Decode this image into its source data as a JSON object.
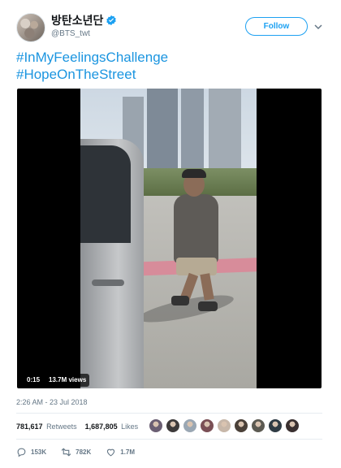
{
  "header": {
    "display_name": "방탄소년단",
    "handle": "@BTS_twt",
    "follow_label": "Follow"
  },
  "tweet": {
    "lines": [
      "#InMyFeelingsChallenge",
      "#HopeOnTheStreet"
    ]
  },
  "video": {
    "duration": "0:15",
    "views": "13.7M views"
  },
  "meta": {
    "timestamp": "2:26 AM - 23 Jul 2018",
    "retweets_count": "781,617",
    "retweets_label": "Retweets",
    "likes_count": "1,687,805",
    "likes_label": "Likes",
    "liker_colors": [
      "#6b5f73",
      "#3d3a3a",
      "#9aa7b3",
      "#7a4f55",
      "#c7b7a9",
      "#4a4038",
      "#5c5a52",
      "#2f3b44",
      "#3a3030"
    ]
  },
  "actions": {
    "replies": "153K",
    "retweets": "782K",
    "likes": "1.7M"
  },
  "colors": {
    "accent": "#1da1f2",
    "link": "#1b95e0",
    "muted": "#657786"
  }
}
